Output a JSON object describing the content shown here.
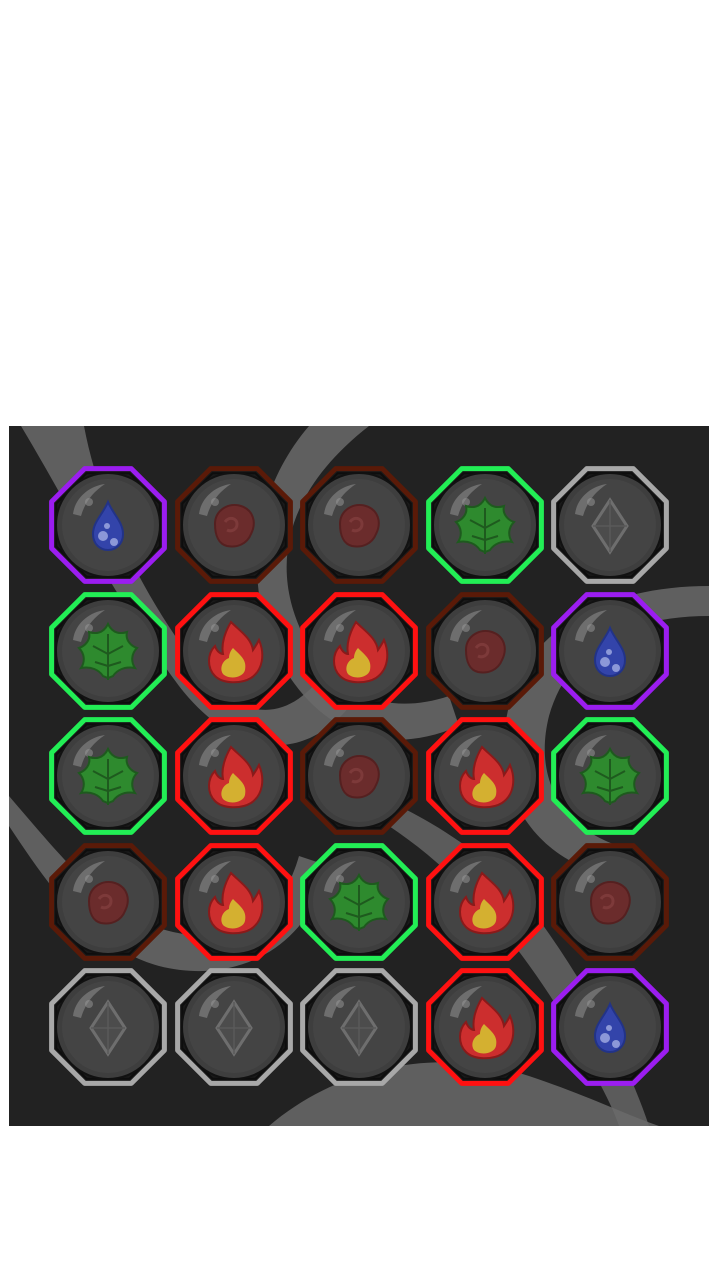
{
  "board": {
    "rows": 5,
    "cols": 5,
    "grid": [
      [
        {
          "type": "water",
          "frame": "purple"
        },
        {
          "type": "ember",
          "frame": "darkred"
        },
        {
          "type": "ember",
          "frame": "darkred"
        },
        {
          "type": "leaf",
          "frame": "green"
        },
        {
          "type": "diamond",
          "frame": "silver"
        }
      ],
      [
        {
          "type": "leaf",
          "frame": "green"
        },
        {
          "type": "fire",
          "frame": "red"
        },
        {
          "type": "fire",
          "frame": "red"
        },
        {
          "type": "ember",
          "frame": "darkred"
        },
        {
          "type": "water",
          "frame": "purple"
        }
      ],
      [
        {
          "type": "leaf",
          "frame": "green"
        },
        {
          "type": "fire",
          "frame": "red"
        },
        {
          "type": "ember",
          "frame": "darkred"
        },
        {
          "type": "fire",
          "frame": "red"
        },
        {
          "type": "leaf",
          "frame": "green"
        }
      ],
      [
        {
          "type": "ember",
          "frame": "darkred"
        },
        {
          "type": "fire",
          "frame": "red"
        },
        {
          "type": "leaf",
          "frame": "green"
        },
        {
          "type": "fire",
          "frame": "red"
        },
        {
          "type": "ember",
          "frame": "darkred"
        }
      ],
      [
        {
          "type": "diamond",
          "frame": "silver"
        },
        {
          "type": "diamond",
          "frame": "silver"
        },
        {
          "type": "diamond",
          "frame": "silver"
        },
        {
          "type": "fire",
          "frame": "red"
        },
        {
          "type": "water",
          "frame": "purple"
        }
      ]
    ]
  },
  "frame_colors": {
    "purple": "#9b1df0",
    "darkred": "#5a1a08",
    "green": "#22ee55",
    "silver": "#a8a8a8",
    "red": "#ff1111"
  },
  "icons": {
    "water": "water-drop-icon",
    "ember": "ember-icon",
    "leaf": "leaf-icon",
    "diamond": "diamond-icon",
    "fire": "flame-icon"
  }
}
